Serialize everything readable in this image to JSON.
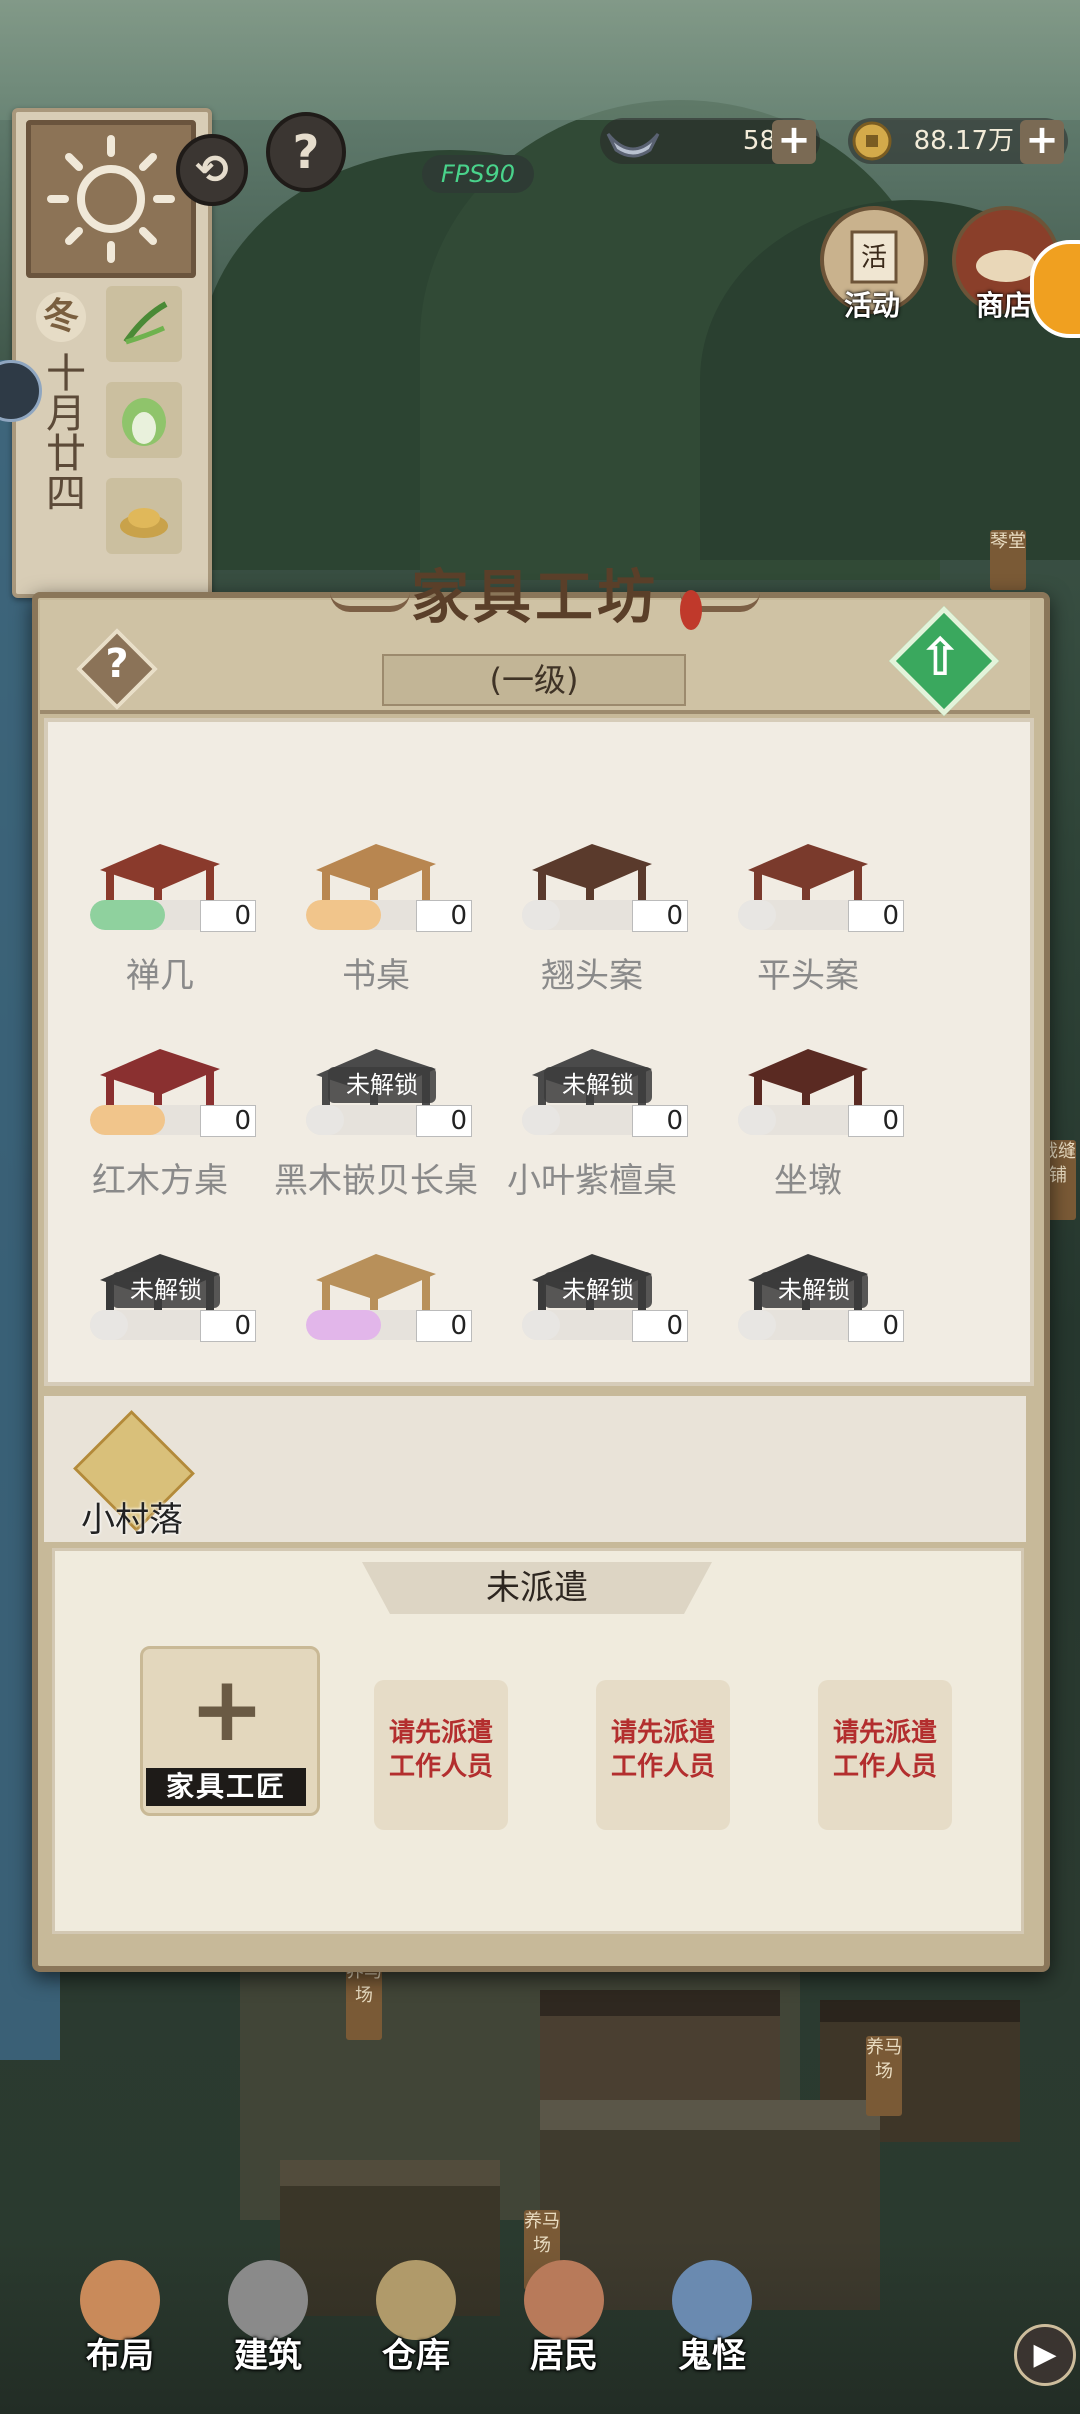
{
  "hud": {
    "season": "冬",
    "date": "十月廿四",
    "silver": "58",
    "coins": "88.17万",
    "fps": "FPS90",
    "activity_label": "活动",
    "shop_label": "商店"
  },
  "dialog": {
    "title": "家具工坊",
    "level": "(一级)",
    "items": [
      {
        "name": "禅几",
        "count": "0",
        "locked": false
      },
      {
        "name": "书桌",
        "count": "0",
        "locked": false
      },
      {
        "name": "翘头案",
        "count": "0",
        "locked": false
      },
      {
        "name": "平头案",
        "count": "0",
        "locked": false
      },
      {
        "name": "红木方桌",
        "count": "0",
        "locked": false
      },
      {
        "name": "黑木嵌贝长桌",
        "count": "0",
        "locked": true
      },
      {
        "name": "小叶紫檀桌",
        "count": "0",
        "locked": true
      },
      {
        "name": "坐墩",
        "count": "0",
        "locked": false
      },
      {
        "name": "",
        "count": "0",
        "locked": true
      },
      {
        "name": "",
        "count": "0",
        "locked": false
      },
      {
        "name": "",
        "count": "0",
        "locked": true
      },
      {
        "name": "",
        "count": "0",
        "locked": true
      }
    ],
    "lock_label": "未解锁",
    "village_label": "小村落",
    "assign_tab": "未派遣",
    "craftsman_label": "家具工匠",
    "slot_hint_line1": "请先派遣",
    "slot_hint_line2": "工作人员"
  },
  "signs": {
    "sign1": "琴堂",
    "sign2": "裁缝铺",
    "sign3": "养马场",
    "sign4": "养马场",
    "sign5": "养马场"
  },
  "nav": [
    {
      "label": "布局"
    },
    {
      "label": "建筑"
    },
    {
      "label": "仓库"
    },
    {
      "label": "居民"
    },
    {
      "label": "鬼怪"
    }
  ]
}
